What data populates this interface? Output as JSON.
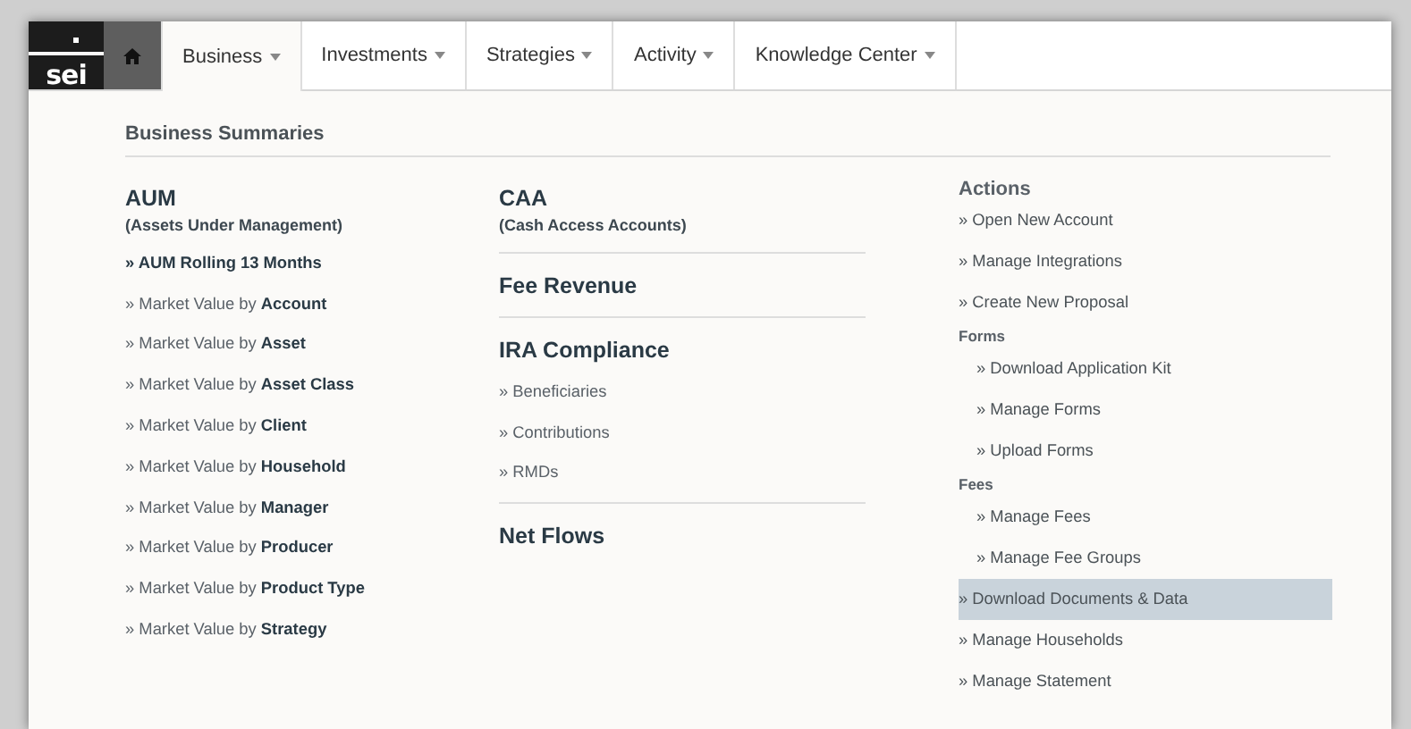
{
  "logo": {
    "text": "sei"
  },
  "nav": {
    "tabs": [
      {
        "label": "Business",
        "selected": true
      },
      {
        "label": "Investments",
        "selected": false
      },
      {
        "label": "Strategies",
        "selected": false
      },
      {
        "label": "Activity",
        "selected": false
      },
      {
        "label": "Knowledge Center",
        "selected": false
      }
    ]
  },
  "page": {
    "title": "Business Summaries"
  },
  "aum": {
    "title": "AUM",
    "subtitle": "(Assets Under Management)",
    "links": [
      {
        "text": "» AUM Rolling 13 Months",
        "bold": true
      },
      {
        "text": "» Market Value by **Account**",
        "bold": false
      },
      {
        "text": "» Market Value by **Asset**",
        "bold": false
      },
      {
        "text": "» Market Value by **Asset Class**",
        "bold": false
      },
      {
        "text": "» Market Value by **Client**",
        "bold": false
      },
      {
        "text": "» Market Value by **Household**",
        "bold": false
      },
      {
        "text": "» Market Value by **Manager**",
        "bold": false
      },
      {
        "text": "» Market Value by **Producer**",
        "bold": false
      },
      {
        "text": "» Market Value by **Product Type**",
        "bold": false
      },
      {
        "text": "» Market Value by **Strategy**",
        "bold": false
      }
    ]
  },
  "middle_sections": [
    {
      "title": "CAA",
      "subtitle": "(Cash Access Accounts)"
    },
    {
      "title": "Fee Revenue"
    },
    {
      "title": "IRA Compliance",
      "links": [
        "» Beneficiaries",
        "» Contributions",
        "» RMDs"
      ]
    },
    {
      "title": "Net Flows"
    }
  ],
  "actions": {
    "title": "Actions",
    "items": [
      {
        "label": "» Open New Account",
        "selected": false
      },
      {
        "label": "» Manage Integrations",
        "selected": false
      },
      {
        "label": "» Create New Proposal",
        "selected": false
      },
      {
        "label": "Forms",
        "children": [
          {
            "label": "» Download Application Kit",
            "selected": false
          },
          {
            "label": "» Manage Forms",
            "selected": false
          },
          {
            "label": "» Upload Forms",
            "selected": false
          }
        ]
      },
      {
        "label": "Fees",
        "children": [
          {
            "label": "» Manage Fees",
            "selected": false
          },
          {
            "label": "» Manage Fee Groups",
            "selected": false
          }
        ]
      },
      {
        "label": "» Download Documents & Data",
        "selected": true
      },
      {
        "label": "» Manage Households",
        "selected": false
      },
      {
        "label": "» Manage Statement",
        "selected": false
      }
    ]
  }
}
